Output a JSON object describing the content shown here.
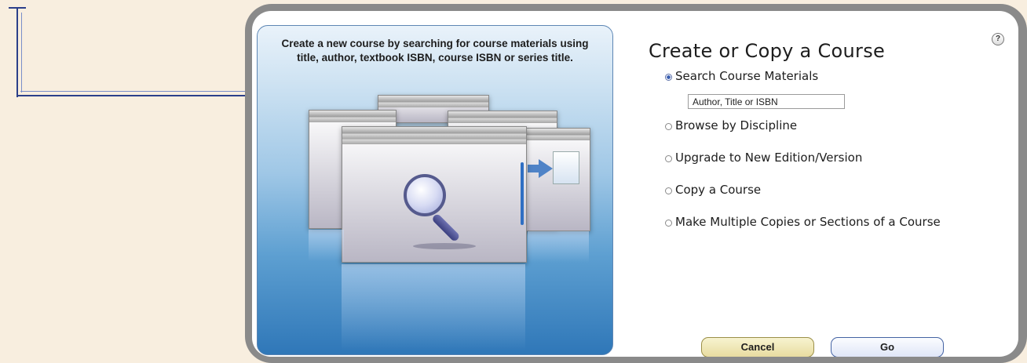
{
  "dialog": {
    "title": "Create or Copy a Course",
    "help_label": "?",
    "description": "Create a new course by searching for course materials using title, author, textbook ISBN, course ISBN or series title.",
    "options": [
      {
        "label": "Search Course Materials",
        "selected": true
      },
      {
        "label": "Browse by Discipline",
        "selected": false
      },
      {
        "label": "Upgrade to New Edition/Version",
        "selected": false
      },
      {
        "label": "Copy a Course",
        "selected": false
      },
      {
        "label": "Make Multiple Copies or Sections of a Course",
        "selected": false
      }
    ],
    "search": {
      "value": "Author, Title or ISBN"
    },
    "buttons": {
      "cancel": "Cancel",
      "go": "Go"
    }
  },
  "colors": {
    "page_bg": "#f8eedf",
    "frame": "#8a8a8a",
    "connector": "#2b3f8a",
    "accent": "#2f77b8"
  },
  "icons": [
    "help-icon",
    "magnifier-icon",
    "document-icon",
    "arrow-icon"
  ]
}
